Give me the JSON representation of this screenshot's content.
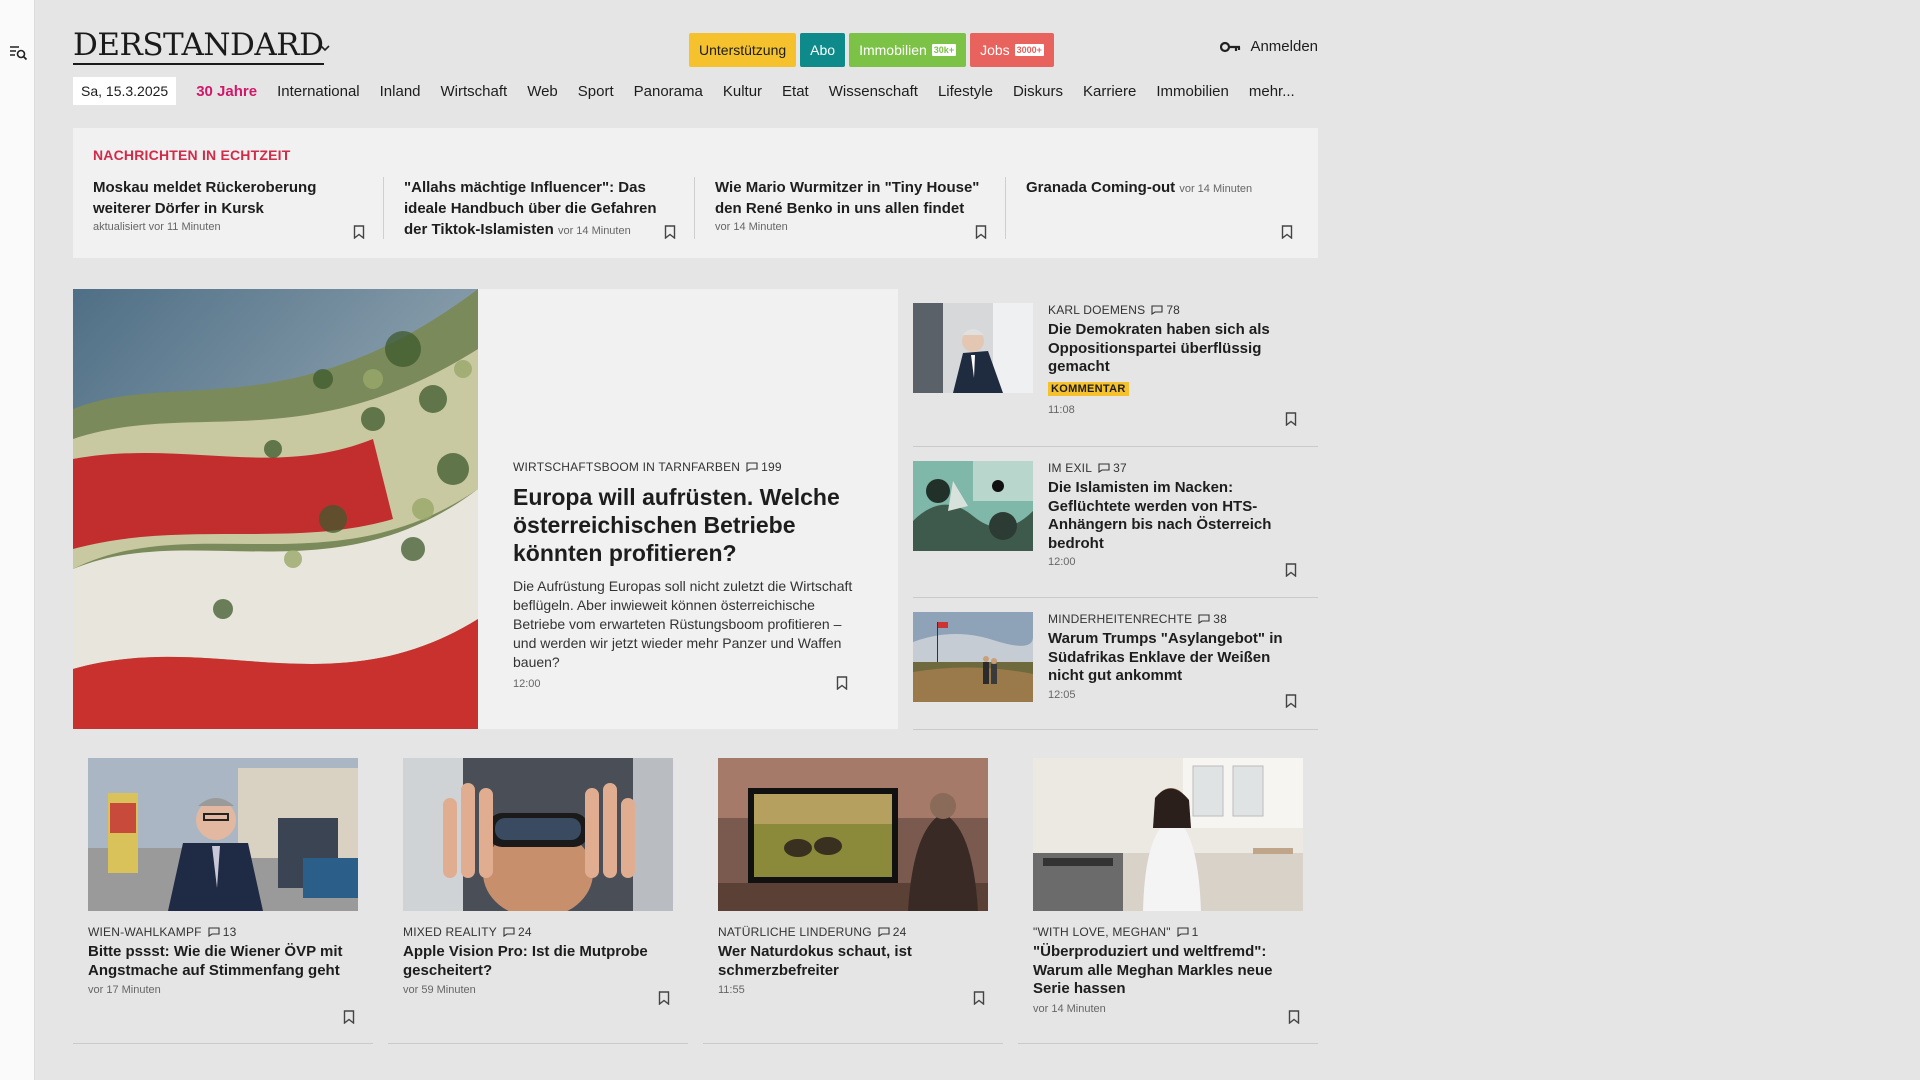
{
  "header": {
    "logo": "DERSTANDARD",
    "promo": {
      "support": "Unterstützung",
      "abo": "Abo",
      "immobilien": "Immobilien",
      "immobilien_badge": "30k+",
      "jobs": "Jobs",
      "jobs_badge": "3000+"
    },
    "login": "Anmelden"
  },
  "nav": {
    "date": "Sa, 15.3.2025",
    "items": [
      "30 Jahre",
      "International",
      "Inland",
      "Wirtschaft",
      "Web",
      "Sport",
      "Panorama",
      "Kultur",
      "Etat",
      "Wissenschaft",
      "Lifestyle",
      "Diskurs",
      "Karriere",
      "Immobilien",
      "mehr..."
    ]
  },
  "ticker": {
    "title": "NACHRICHTEN IN ECHTZEIT",
    "items": [
      {
        "headline": "Moskau meldet Rückeroberung weiterer Dörfer in Kursk",
        "time": "aktualisiert vor 11 Minuten"
      },
      {
        "headline": "\"Allahs mächtige Influencer\": Das ideale Handbuch über die Gefahren der Tiktok-Islamisten",
        "time": "vor 14 Minuten"
      },
      {
        "headline": "Wie Mario Wurmitzer in \"Tiny House\" den René Benko in uns allen findet",
        "time": "vor 14 Minuten"
      },
      {
        "headline": "Granada Coming-out",
        "time": "vor 14 Minuten"
      }
    ]
  },
  "hero": {
    "kicker": "WIRTSCHAFTSBOOM IN TARNFARBEN",
    "comments": "199",
    "title": "Europa will aufrüsten. Welche österreichischen Betriebe könnten profitieren?",
    "lead": "Die Aufrüstung Europas soll nicht zuletzt die Wirtschaft beflügeln. Aber inwieweit können österreichische Betriebe vom erwarteten Rüstungsboom profitieren – und werden wir jetzt wieder mehr Panzer und Waffen bauen?",
    "time": "12:00"
  },
  "side": [
    {
      "kicker": "KARL DOEMENS",
      "comments": "78",
      "title": "Die Demokraten haben sich als Oppositionspartei überflüssig gemacht",
      "badge": "KOMMENTAR",
      "time": "11:08"
    },
    {
      "kicker": "IM EXIL",
      "comments": "37",
      "title": "Die Islamisten im Nacken: Geflüchtete werden von HTS-Anhängern bis nach Österreich bedroht",
      "time": "12:00"
    },
    {
      "kicker": "MINDERHEITENRECHTE",
      "comments": "38",
      "title": "Warum Trumps \"Asylangebot\" in Südafrikas Enklave der Weißen nicht gut ankommt",
      "time": "12:05"
    }
  ],
  "cards": [
    {
      "kicker": "WIEN-WAHLKAMPF",
      "comments": "13",
      "title": "Bitte pssst: Wie die Wiener ÖVP mit Angstmache auf Stimmenfang geht",
      "time": "vor 17 Minuten"
    },
    {
      "kicker": "MIXED REALITY",
      "comments": "24",
      "title": "Apple Vision Pro: Ist die Mutprobe gescheitert?",
      "time": "vor 59 Minuten"
    },
    {
      "kicker": "NATÜRLICHE LINDERUNG",
      "comments": "24",
      "title": "Wer Naturdokus schaut, ist schmerzbefreiter",
      "time": "11:55"
    },
    {
      "kicker": "\"WITH LOVE, MEGHAN\"",
      "comments": "1",
      "title": "\"Überproduziert und weltfremd\": Warum alle Meghan Markles neue Serie hassen",
      "time": "vor 14 Minuten"
    }
  ],
  "colors": {
    "accent_live": "#d02c4a",
    "jahre": "#d0186a",
    "support": "#f5c22e",
    "abo": "#0e8a8a",
    "immobilien": "#7cc246",
    "jobs": "#e8625e"
  },
  "icons": {
    "rail": "menu-search-icon",
    "login": "key-icon",
    "comment": "comment-icon",
    "bookmark": "bookmark-icon",
    "logo_menu": "chevron-down-icon"
  }
}
